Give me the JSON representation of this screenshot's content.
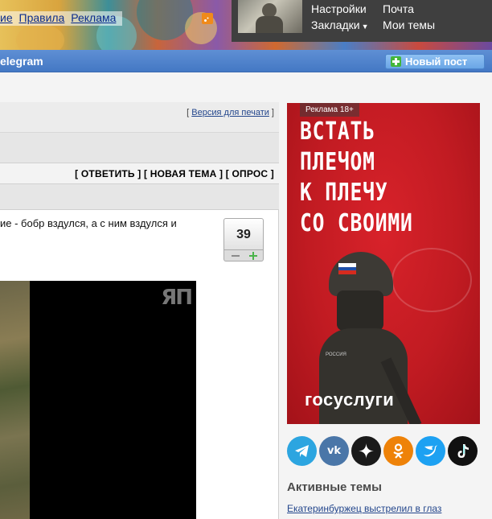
{
  "header": {
    "links": [
      "ие",
      "Правила",
      "Реклама"
    ],
    "user_menu": {
      "settings": "Настройки",
      "mail": "Почта",
      "bookmarks": "Закладки",
      "my_topics": "Мои темы"
    }
  },
  "navbar": {
    "title": "elegram",
    "new_post": "Новый пост"
  },
  "topic": {
    "print_prefix": "[ ",
    "print_link": "Версия для печати",
    "print_suffix": " ]",
    "actions": [
      "[ ОТВЕТИТЬ ]",
      "[ НОВАЯ ТЕМА ]",
      "[ ОПРОС ]"
    ],
    "post_text_line1": "ие - бобр вздулся, а с ним вздулся и",
    "rating": "39",
    "video_logo": "ЯП"
  },
  "sidebar": {
    "ad_label": "Реклама 18+",
    "ad_lines": [
      "ВСТАТЬ",
      "ПЛЕЧОМ",
      "К ПЛЕЧУ",
      "СО СВОИМИ"
    ],
    "ad_brand": "госуслуги",
    "flag_caption": "РОССИЯ",
    "socials": [
      {
        "name": "telegram",
        "color": "#2ca5e0"
      },
      {
        "name": "vk",
        "color": "#4a76a8"
      },
      {
        "name": "zen",
        "color": "#1a1a1a"
      },
      {
        "name": "odnoklassniki",
        "color": "#ee8208"
      },
      {
        "name": "twitter",
        "color": "#1da1f2"
      },
      {
        "name": "tiktok",
        "color": "#111111"
      }
    ],
    "active_topics_heading": "Активные темы",
    "active_topics": [
      "Екатеринбуржец выстрелил в глаз"
    ]
  },
  "colors": {
    "nav_blue": "#4d82cc",
    "ad_red": "#c51c23",
    "link_blue": "#23468c"
  }
}
